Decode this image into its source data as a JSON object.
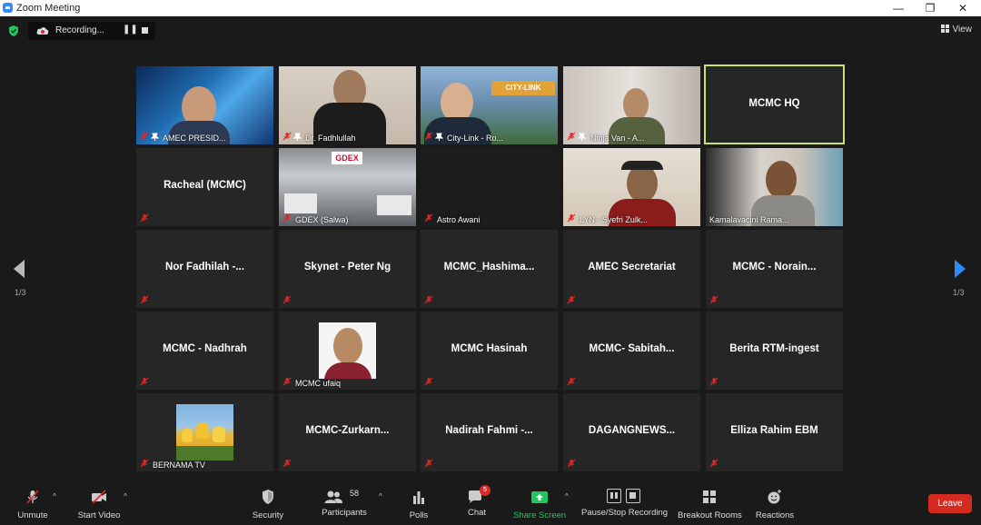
{
  "window": {
    "title": "Zoom Meeting",
    "controls": [
      "—",
      "❐",
      "✕"
    ]
  },
  "recording": {
    "label": "Recording..."
  },
  "view": {
    "label": "View"
  },
  "pagination": {
    "left": "1/3",
    "right": "1/3"
  },
  "tiles": [
    {
      "label": "AMEC PRESID...",
      "video": true,
      "pinned": true
    },
    {
      "label": "Dr. Fadhlullah",
      "video": true,
      "pinned": true
    },
    {
      "label": "City-Link - Ro...",
      "video": true,
      "pinned": true
    },
    {
      "label": "Ninja Van - A...",
      "video": true,
      "pinned": true
    },
    {
      "name": "MCMC HQ",
      "video": false,
      "active": true
    },
    {
      "name": "Racheal (MCMC)",
      "video": false
    },
    {
      "label": "GDEX (Salwa)",
      "video": true
    },
    {
      "label": "Astro Awani",
      "video": true
    },
    {
      "label": "LYN - Syefri Zulk...",
      "video": true
    },
    {
      "label": "Kamalavacini Rama...",
      "video": true
    },
    {
      "name": "Nor Fadhilah -...",
      "video": false
    },
    {
      "name": "Skynet - Peter Ng",
      "video": false
    },
    {
      "name": "MCMC_Hashima...",
      "video": false
    },
    {
      "name": "AMEC Secretariat",
      "video": false
    },
    {
      "name": "MCMC -  Norain...",
      "video": false
    },
    {
      "name": "MCMC - Nadhrah",
      "video": false
    },
    {
      "label": "MCMC ufaiq",
      "video": false,
      "avatar": "person"
    },
    {
      "name": "MCMC Hasinah",
      "video": false
    },
    {
      "name": "MCMC-  Sabitah...",
      "video": false
    },
    {
      "name": "Berita RTM-ingest",
      "video": false
    },
    {
      "label": "BERNAMA TV",
      "video": false,
      "avatar": "tulips"
    },
    {
      "name": "MCMC-Zurkarn...",
      "video": false
    },
    {
      "name": "Nadirah Fahmi -...",
      "video": false
    },
    {
      "name": "DAGANGNEWS...",
      "video": false
    },
    {
      "name": "Elliza Rahim EBM",
      "video": false
    }
  ],
  "toolbar": {
    "unmute": "Unmute",
    "start_video": "Start Video",
    "security": "Security",
    "participants": "Participants",
    "participants_count": "58",
    "polls": "Polls",
    "chat": "Chat",
    "chat_badge": "5",
    "share_screen": "Share Screen",
    "pause_recording": "Pause/Stop Recording",
    "breakout": "Breakout Rooms",
    "reactions": "Reactions",
    "leave": "Leave"
  },
  "colors": {
    "accent": "#2d8cff",
    "active_border": "#c8e26a",
    "leave": "#d52b1e",
    "share": "#22c55e",
    "muted": "#e02828"
  }
}
